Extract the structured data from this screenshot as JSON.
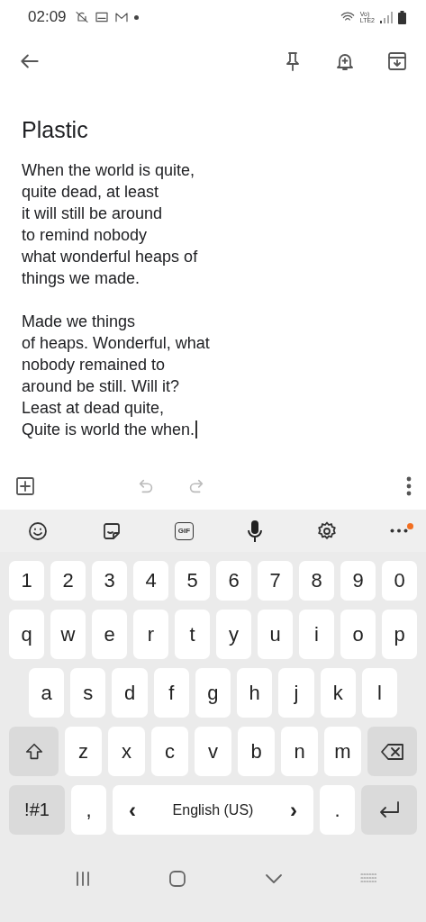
{
  "status_bar": {
    "time": "02:09",
    "network_top": "Vo)",
    "network_bottom": "LTE2"
  },
  "note": {
    "title": "Plastic",
    "paragraphs": [
      [
        "When the world is quite,",
        "quite dead, at least",
        "it will still be around",
        "to remind nobody",
        "what wonderful heaps of",
        "things we made."
      ],
      [
        "Made we things",
        "of heaps. Wonderful, what",
        "nobody remained to",
        "around be still. Will it?",
        "Least at dead quite,",
        "Quite is world the when."
      ]
    ]
  },
  "editor_bar": {
    "undo_disabled": true,
    "redo_disabled": true
  },
  "keyboard_toolbar": {
    "gif_label": "GIF",
    "more_badge": true
  },
  "keyboard": {
    "rows": [
      {
        "keys": [
          {
            "kind": "char",
            "label": "1"
          },
          {
            "kind": "char",
            "label": "2"
          },
          {
            "kind": "char",
            "label": "3"
          },
          {
            "kind": "char",
            "label": "4"
          },
          {
            "kind": "char",
            "label": "5"
          },
          {
            "kind": "char",
            "label": "6"
          },
          {
            "kind": "char",
            "label": "7"
          },
          {
            "kind": "char",
            "label": "8"
          },
          {
            "kind": "char",
            "label": "9"
          },
          {
            "kind": "char",
            "label": "0"
          }
        ]
      },
      {
        "keys": [
          {
            "kind": "char",
            "label": "q"
          },
          {
            "kind": "char",
            "label": "w"
          },
          {
            "kind": "char",
            "label": "e"
          },
          {
            "kind": "char",
            "label": "r"
          },
          {
            "kind": "char",
            "label": "t"
          },
          {
            "kind": "char",
            "label": "y"
          },
          {
            "kind": "char",
            "label": "u"
          },
          {
            "kind": "char",
            "label": "i"
          },
          {
            "kind": "char",
            "label": "o"
          },
          {
            "kind": "char",
            "label": "p"
          }
        ]
      },
      {
        "keys": [
          {
            "kind": "char",
            "label": "a"
          },
          {
            "kind": "char",
            "label": "s"
          },
          {
            "kind": "char",
            "label": "d"
          },
          {
            "kind": "char",
            "label": "f"
          },
          {
            "kind": "char",
            "label": "g"
          },
          {
            "kind": "char",
            "label": "h"
          },
          {
            "kind": "char",
            "label": "j"
          },
          {
            "kind": "char",
            "label": "k"
          },
          {
            "kind": "char",
            "label": "l"
          }
        ]
      },
      {
        "keys": [
          {
            "kind": "shift"
          },
          {
            "kind": "char",
            "label": "z"
          },
          {
            "kind": "char",
            "label": "x"
          },
          {
            "kind": "char",
            "label": "c"
          },
          {
            "kind": "char",
            "label": "v"
          },
          {
            "kind": "char",
            "label": "b"
          },
          {
            "kind": "char",
            "label": "n"
          },
          {
            "kind": "char",
            "label": "m"
          },
          {
            "kind": "backspace"
          }
        ]
      },
      {
        "keys": [
          {
            "kind": "symbols",
            "label": "!#1"
          },
          {
            "kind": "char",
            "label": ","
          },
          {
            "kind": "space",
            "label": "English (US)",
            "left": "‹",
            "right": "›"
          },
          {
            "kind": "char",
            "label": "."
          },
          {
            "kind": "enter"
          }
        ]
      }
    ]
  }
}
